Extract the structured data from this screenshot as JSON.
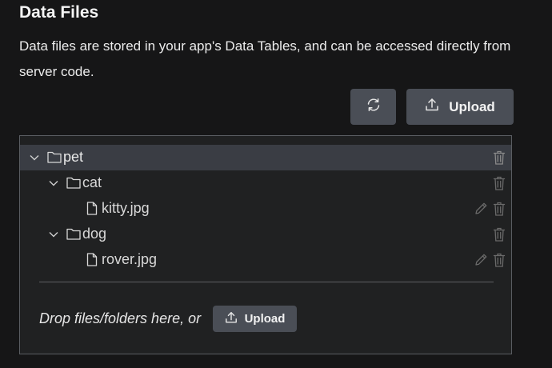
{
  "header": {
    "title": "Data Files",
    "description": "Data files are stored in your app's Data Tables, and can be accessed directly from server code."
  },
  "toolbar": {
    "refresh_icon": "refresh-icon",
    "upload_label": "Upload",
    "upload_icon": "upload-icon"
  },
  "tree": {
    "items": [
      {
        "name": "pet",
        "type": "folder",
        "expanded": true,
        "selected": true
      },
      {
        "name": "cat",
        "type": "folder",
        "expanded": true
      },
      {
        "name": "kitty.jpg",
        "type": "file"
      },
      {
        "name": "dog",
        "type": "folder",
        "expanded": true
      },
      {
        "name": "rover.jpg",
        "type": "file"
      }
    ]
  },
  "dropzone": {
    "text": "Drop files/folders here, or",
    "upload_label": "Upload"
  },
  "colors": {
    "background": "#161617",
    "panel": "#202122",
    "selected_row": "#3a3d44",
    "button": "#4a4e56"
  }
}
